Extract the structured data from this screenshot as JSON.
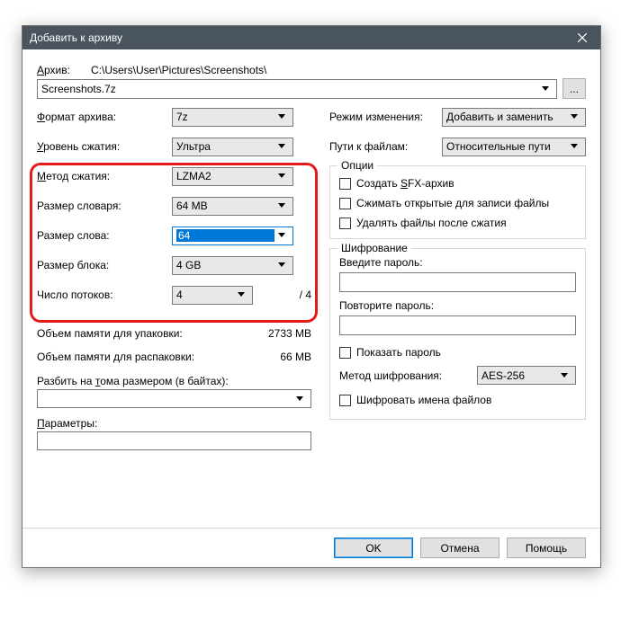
{
  "title": "Добавить к архиву",
  "archive_path_label_pre": "А",
  "archive_path_label_post": "рхив:",
  "archive_path_dir": "C:\\Users\\User\\Pictures\\Screenshots\\",
  "archive_filename": "Screenshots.7z",
  "left": {
    "format_label_pre": "Ф",
    "format_label_post": "ормат архива:",
    "format_value": "7z",
    "level_label_pre": "У",
    "level_label_post": "ровень сжатия:",
    "level_value": "Ультра",
    "method_label_pre": "М",
    "method_label_post": "етод сжатия:",
    "method_value": "LZMA2",
    "dict_label": "Размер словаря:",
    "dict_value": "64 MB",
    "word_label": "Размер слова:",
    "word_value": "64",
    "block_label": "Размер блока:",
    "block_value": "4 GB",
    "threads_label": "Число потоков:",
    "threads_value": "4",
    "threads_max": "/ 4",
    "mem_pack_label": "Объем памяти для упаковки:",
    "mem_pack_value": "2733 MB",
    "mem_unpack_label": "Объем памяти для распаковки:",
    "mem_unpack_value": "66 MB",
    "split_label_pre": "Разбить на ",
    "split_label_u": "т",
    "split_label_post": "ома размером (в байтах):",
    "params_label_pre": "П",
    "params_label_post": "араметры:"
  },
  "right": {
    "mode_label": "Режим изменения:",
    "mode_value": "Добавить и заменить",
    "paths_label": "Пути к файлам:",
    "paths_value": "Относительные пути",
    "options_legend": "Опции",
    "opt_sfx_pre": "Создать ",
    "opt_sfx_u": "S",
    "opt_sfx_post": "FX-архив",
    "opt_shared": "Сжимать открытые для записи файлы",
    "opt_delete": "Удалять файлы после сжатия",
    "enc_legend": "Шифрование",
    "pw1_label": "Введите пароль:",
    "pw2_label": "Повторите пароль:",
    "showpw_label": "Показать пароль",
    "enc_method_label": "Метод шифрования:",
    "enc_method_value": "AES-256",
    "enc_names_label": "Шифровать имена файлов"
  },
  "footer": {
    "ok": "OK",
    "cancel": "Отмена",
    "help": "Помощь"
  }
}
